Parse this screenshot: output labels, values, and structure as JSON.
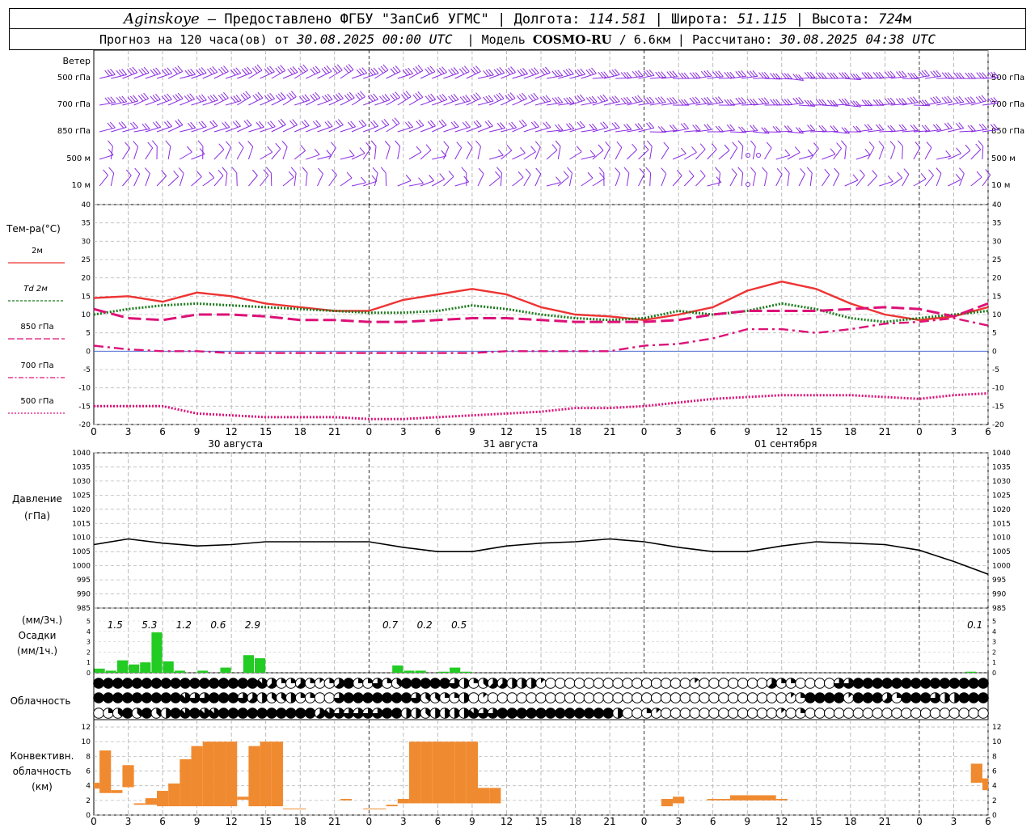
{
  "header": {
    "station": "Aginskoye",
    "provider": "– Предоставлено ФГБУ \"ЗапСиб УГМС\"",
    "lon_label": "Долгота:",
    "lon": "114.581",
    "lat_label": "Широта:",
    "lat": "51.115",
    "alt_label": "Высота:",
    "alt": "724",
    "alt_unit": "м",
    "forecast_prefix": "Прогноз на 120 часа(ов) от",
    "forecast_time": "30.08.2025 00:00 UTC",
    "model_label": "Модель",
    "model": "COSMO-RU",
    "resolution": "/ 6.6км",
    "calc_label": "Рассчитано:",
    "calc_time": "30.08.2025 04:38 UTC"
  },
  "x_axis": {
    "tick_labels": [
      "0",
      "3",
      "6",
      "9",
      "12",
      "15",
      "18",
      "21",
      "0",
      "3",
      "6",
      "9",
      "12",
      "15",
      "18",
      "21",
      "0",
      "3",
      "6",
      "9",
      "12",
      "15",
      "18",
      "21",
      "0",
      "3",
      "6"
    ],
    "day_labels": [
      "30 августа",
      "31 августа",
      "01 сентября"
    ]
  },
  "wind_panel": {
    "title": "Ветер",
    "levels": [
      "500 гПа",
      "700 гПа",
      "850 гПа",
      "500 м",
      "10 м"
    ],
    "color": "#8a2be2"
  },
  "chart_data": [
    {
      "type": "line",
      "title": "Тем-ра(°С)",
      "x_unit": "hours from 30.08.2025 00:00 UTC",
      "ylim": [
        -20,
        40
      ],
      "y_ticks": [
        "40",
        "35",
        "30",
        "25",
        "20",
        "15",
        "10",
        "5",
        "0",
        "-5",
        "-10",
        "-15",
        "-20"
      ],
      "grid": true,
      "legend_placement": "left",
      "x": [
        0,
        3,
        6,
        9,
        12,
        15,
        18,
        21,
        24,
        27,
        30,
        33,
        36,
        39,
        42,
        45,
        48,
        51,
        54,
        57,
        60,
        63,
        66,
        69,
        72,
        75,
        78
      ],
      "series": [
        {
          "name": "2м",
          "color": "#ee3333",
          "style": "solid",
          "values": [
            14.5,
            15,
            13.5,
            16,
            15,
            13,
            12,
            11,
            11,
            14,
            15.5,
            17,
            15.5,
            12,
            10,
            9.5,
            8.5,
            10,
            12,
            16.5,
            19,
            17,
            13,
            10,
            8.5,
            9.5,
            12
          ]
        },
        {
          "name": "Td 2м",
          "color": "#1a7a1a",
          "style": "dotted",
          "values": [
            10,
            11.5,
            12.5,
            13,
            12.5,
            12,
            11.5,
            11,
            10.5,
            10.5,
            11,
            12.5,
            11.5,
            10,
            9,
            8.5,
            9,
            11,
            10,
            11,
            13,
            11.5,
            9,
            8,
            9,
            10,
            11
          ]
        },
        {
          "name": "850 гПа",
          "color": "#dd1177",
          "style": "long-dash",
          "values": [
            11.5,
            9,
            8.5,
            10,
            10,
            9.5,
            8.5,
            8.5,
            8,
            8,
            8.5,
            9,
            9,
            8.5,
            8,
            8,
            8,
            8.5,
            10,
            11,
            11,
            11,
            11.5,
            12,
            11.5,
            9.5,
            13
          ]
        },
        {
          "name": "700 гПа",
          "color": "#dd1177",
          "style": "dash-dot",
          "values": [
            1.5,
            0.5,
            0,
            0,
            -0.5,
            -0.5,
            -0.5,
            -0.5,
            -0.5,
            -0.5,
            -0.5,
            -0.5,
            0,
            0,
            0,
            0,
            1.5,
            2,
            3.5,
            6,
            6,
            5,
            6,
            7.5,
            8,
            9,
            7
          ]
        },
        {
          "name": "500 гПа",
          "color": "#dd1177",
          "style": "dotted",
          "values": [
            -15,
            -15,
            -15,
            -17,
            -17.5,
            -18,
            -18,
            -18,
            -18.5,
            -18.5,
            -18,
            -17.5,
            -17,
            -16.5,
            -15.5,
            -15.5,
            -15,
            -14,
            -13,
            -12.5,
            -12,
            -12,
            -12,
            -12.5,
            -13,
            -12,
            -11.5
          ]
        }
      ]
    },
    {
      "type": "line",
      "title": "Давление",
      "ylabel": "(гПа)",
      "ylim": [
        985,
        1040
      ],
      "y_ticks": [
        "1040",
        "1035",
        "1030",
        "1025",
        "1020",
        "1015",
        "1010",
        "1005",
        "1000",
        "995",
        "990",
        "985"
      ],
      "grid": true,
      "x": [
        0,
        3,
        6,
        9,
        12,
        15,
        18,
        21,
        24,
        27,
        30,
        33,
        36,
        39,
        42,
        45,
        48,
        51,
        54,
        57,
        60,
        63,
        66,
        69,
        72,
        75,
        78
      ],
      "series": [
        {
          "color": "#000000",
          "values": [
            1007.5,
            1009.5,
            1008,
            1007,
            1007.5,
            1008.5,
            1008.5,
            1008.5,
            1008.5,
            1006.5,
            1005,
            1005,
            1007,
            1008,
            1008.5,
            1009.5,
            1008.5,
            1006.5,
            1005,
            1005,
            1007,
            1008.5,
            1008,
            1007.5,
            1005.5,
            1001.5,
            997
          ]
        }
      ]
    },
    {
      "type": "bar",
      "title": "Осадки",
      "ylabel_top": "(мм/3ч.)",
      "ylabel_bottom": "(мм/1ч.)",
      "y_ticks_left": [
        "5",
        "4",
        "3",
        "2",
        "1",
        "0"
      ],
      "y_ticks_right": [
        "5",
        "4",
        "3",
        "2",
        "1",
        "0"
      ],
      "color": "#22cc22",
      "hourly_bars": [
        {
          "hour": 0.5,
          "value": 0.4
        },
        {
          "hour": 1.5,
          "value": 0.2
        },
        {
          "hour": 2.5,
          "value": 1.2
        },
        {
          "hour": 3.5,
          "value": 0.8
        },
        {
          "hour": 4.5,
          "value": 1.0
        },
        {
          "hour": 5.5,
          "value": 3.9
        },
        {
          "hour": 6.5,
          "value": 1.1
        },
        {
          "hour": 7.5,
          "value": 0.2
        },
        {
          "hour": 9.5,
          "value": 0.2
        },
        {
          "hour": 11.5,
          "value": 0.5
        },
        {
          "hour": 13.5,
          "value": 1.7
        },
        {
          "hour": 14.5,
          "value": 1.4
        },
        {
          "hour": 26.5,
          "value": 0.7
        },
        {
          "hour": 27.5,
          "value": 0.2
        },
        {
          "hour": 28.5,
          "value": 0.2
        },
        {
          "hour": 30.5,
          "value": 0.1
        },
        {
          "hour": 31.5,
          "value": 0.5
        },
        {
          "hour": 32.5,
          "value": 0.1
        },
        {
          "hour": 76.5,
          "value": 0.1
        }
      ],
      "totals_3h": [
        {
          "hour": 1.5,
          "label": "1.5"
        },
        {
          "hour": 4.5,
          "label": "5.3"
        },
        {
          "hour": 7.5,
          "label": "1.2"
        },
        {
          "hour": 10.5,
          "label": "0.6"
        },
        {
          "hour": 13.5,
          "label": "2.9"
        },
        {
          "hour": 25.5,
          "label": "0.7"
        },
        {
          "hour": 28.5,
          "label": "0.2"
        },
        {
          "hour": 31.5,
          "label": "0.5"
        },
        {
          "hour": 76.5,
          "label": "0.1"
        }
      ]
    },
    {
      "type": "bar",
      "title": "Конвективн. облачность",
      "ylabel": "(км)",
      "ylim": [
        0,
        13
      ],
      "y_ticks": [
        "12",
        "10",
        "8",
        "6",
        "4",
        "2",
        "0"
      ],
      "color": "#f08a30",
      "bars": [
        {
          "from": 0,
          "to": 0.5,
          "base": 3.6,
          "top": 4.4
        },
        {
          "from": 0.5,
          "to": 1.5,
          "base": 3.0,
          "top": 8.8
        },
        {
          "from": 1.5,
          "to": 2.5,
          "base": 3.0,
          "top": 3.4
        },
        {
          "from": 2.5,
          "to": 3.5,
          "base": 3.8,
          "top": 6.8
        },
        {
          "from": 3.5,
          "to": 4.5,
          "base": 1.4,
          "top": 1.6
        },
        {
          "from": 4.5,
          "to": 5.5,
          "base": 1.4,
          "top": 2.3
        },
        {
          "from": 5.5,
          "to": 6.5,
          "base": 1.2,
          "top": 3.3
        },
        {
          "from": 6.5,
          "to": 7.5,
          "base": 1.2,
          "top": 4.3
        },
        {
          "from": 7.5,
          "to": 8.5,
          "base": 1.2,
          "top": 7.6
        },
        {
          "from": 8.5,
          "to": 9.5,
          "base": 1.2,
          "top": 9.4
        },
        {
          "from": 9.5,
          "to": 10.5,
          "base": 1.2,
          "top": 10.0
        },
        {
          "from": 10.5,
          "to": 11.5,
          "base": 1.2,
          "top": 10.0
        },
        {
          "from": 11.5,
          "to": 12.5,
          "base": 1.2,
          "top": 10.0
        },
        {
          "from": 12.5,
          "to": 13.5,
          "base": 2.1,
          "top": 2.5
        },
        {
          "from": 13.5,
          "to": 14.5,
          "base": 1.2,
          "top": 9.4
        },
        {
          "from": 14.5,
          "to": 15.5,
          "base": 1.2,
          "top": 10.0
        },
        {
          "from": 15.5,
          "to": 16.5,
          "base": 1.2,
          "top": 10.0
        },
        {
          "from": 16.5,
          "to": 18.5,
          "base": 0.8,
          "top": 0.9
        },
        {
          "from": 21.5,
          "to": 22.5,
          "base": 2.0,
          "top": 2.2
        },
        {
          "from": 23.5,
          "to": 25.5,
          "base": 0.8,
          "top": 0.9
        },
        {
          "from": 25.5,
          "to": 26.5,
          "base": 1.2,
          "top": 1.4
        },
        {
          "from": 26.5,
          "to": 27.5,
          "base": 1.6,
          "top": 2.2
        },
        {
          "from": 27.5,
          "to": 28.5,
          "base": 1.6,
          "top": 10.0
        },
        {
          "from": 28.5,
          "to": 29.5,
          "base": 1.6,
          "top": 10.0
        },
        {
          "from": 29.5,
          "to": 30.5,
          "base": 1.6,
          "top": 10.0
        },
        {
          "from": 30.5,
          "to": 31.5,
          "base": 1.6,
          "top": 10.0
        },
        {
          "from": 31.5,
          "to": 32.5,
          "base": 1.6,
          "top": 10.0
        },
        {
          "from": 32.5,
          "to": 33.5,
          "base": 1.6,
          "top": 10.0
        },
        {
          "from": 33.5,
          "to": 34.5,
          "base": 1.6,
          "top": 3.7
        },
        {
          "from": 34.5,
          "to": 35.5,
          "base": 1.6,
          "top": 3.7
        },
        {
          "from": 49.5,
          "to": 50.5,
          "base": 1.2,
          "top": 2.2
        },
        {
          "from": 50.5,
          "to": 51.5,
          "base": 1.6,
          "top": 2.5
        },
        {
          "from": 53.5,
          "to": 54.5,
          "base": 2.0,
          "top": 2.2
        },
        {
          "from": 54.5,
          "to": 55.5,
          "base": 2.0,
          "top": 2.2
        },
        {
          "from": 55.5,
          "to": 59.5,
          "base": 2.0,
          "top": 2.7
        },
        {
          "from": 59.5,
          "to": 60.5,
          "base": 2.0,
          "top": 2.2
        },
        {
          "from": 76.5,
          "to": 77.5,
          "base": 4.4,
          "top": 7.0
        },
        {
          "from": 77.5,
          "to": 78,
          "base": 3.4,
          "top": 5.0
        }
      ]
    }
  ],
  "cloud_panel": {
    "title": "Облачность",
    "rows": [
      "888888888888888887522521258226238888864235544410000000000000001000000052200006688888888888888",
      "888888888766888654334220068888888633224010000000000000000000000000000000128888188852888644888",
      "023838348787788888888885766666884434444766888888888888400210000000000001020000000000000000000"
    ]
  }
}
